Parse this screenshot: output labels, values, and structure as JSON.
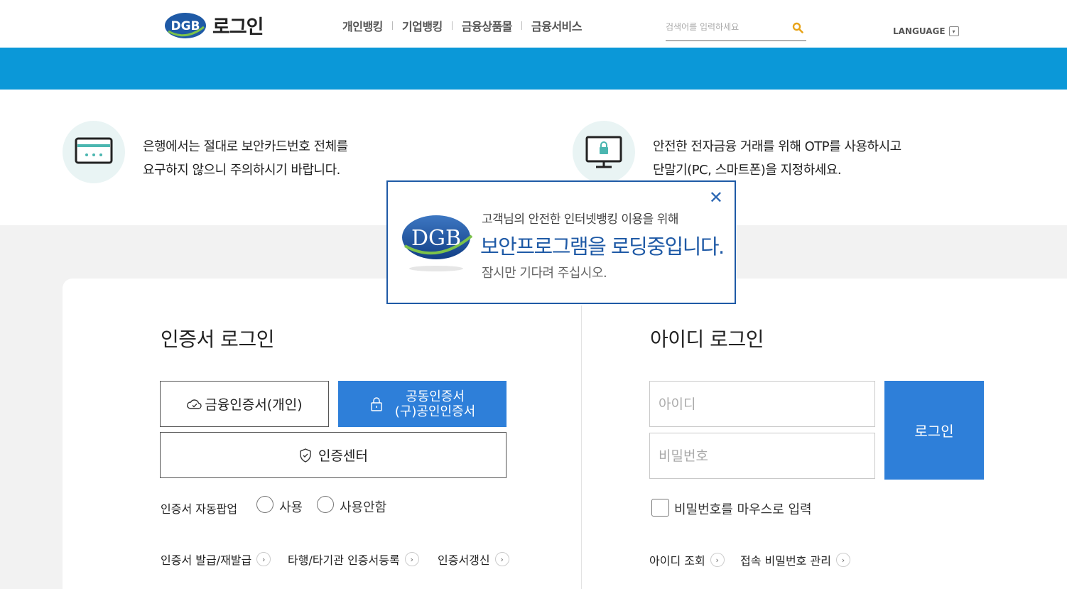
{
  "header": {
    "logo_text": "DGB",
    "title": "로그인",
    "nav": [
      "개인뱅킹",
      "기업뱅킹",
      "금융상품몰",
      "금융서비스"
    ],
    "search_placeholder": "검색어를 입력하세요",
    "language_label": "LANGUAGE"
  },
  "notices": [
    {
      "icon": "security-card-icon",
      "lines": [
        "은행에서는 절대로 보안카드번호 전체를",
        "요구하지 않으니 주의하시기 바랍니다."
      ]
    },
    {
      "icon": "monitor-lock-icon",
      "lines": [
        "안전한 전자금융 거래를 위해 OTP를 사용하시고",
        "단말기(PC, 스마트폰)을 지정하세요."
      ]
    }
  ],
  "cert_login": {
    "title": "인증서 로그인",
    "financial_cert_label": "금융인증서(개인)",
    "joint_cert_label_1": "공동인증서",
    "joint_cert_label_2": "(구)공인인증서",
    "cert_center_label": "인증센터",
    "auto_popup_label": "인증서 자동팝업",
    "auto_popup_options": [
      "사용",
      "사용안함"
    ],
    "links": [
      "인증서 발급/재발급",
      "타행/타기관 인증서등록",
      "인증서갱신"
    ]
  },
  "id_login": {
    "title": "아이디 로그인",
    "id_placeholder": "아이디",
    "password_placeholder": "비밀번호",
    "login_label": "로그인",
    "mouse_input_label": "비밀번호를 마우스로 입력",
    "links": [
      "아이디 조회",
      "접속 비밀번호 관리"
    ]
  },
  "popup": {
    "logo_text": "DGB",
    "line1": "고객님의 안전한 인터넷뱅킹 이용을 위해",
    "line2": "보안프로그램을 로딩중입니다.",
    "line3": "잠시만 기다려 주십시오."
  },
  "colors": {
    "band": "#0b98d8",
    "primary_button": "#2e7fd9",
    "popup_border": "#1f5aa6"
  }
}
